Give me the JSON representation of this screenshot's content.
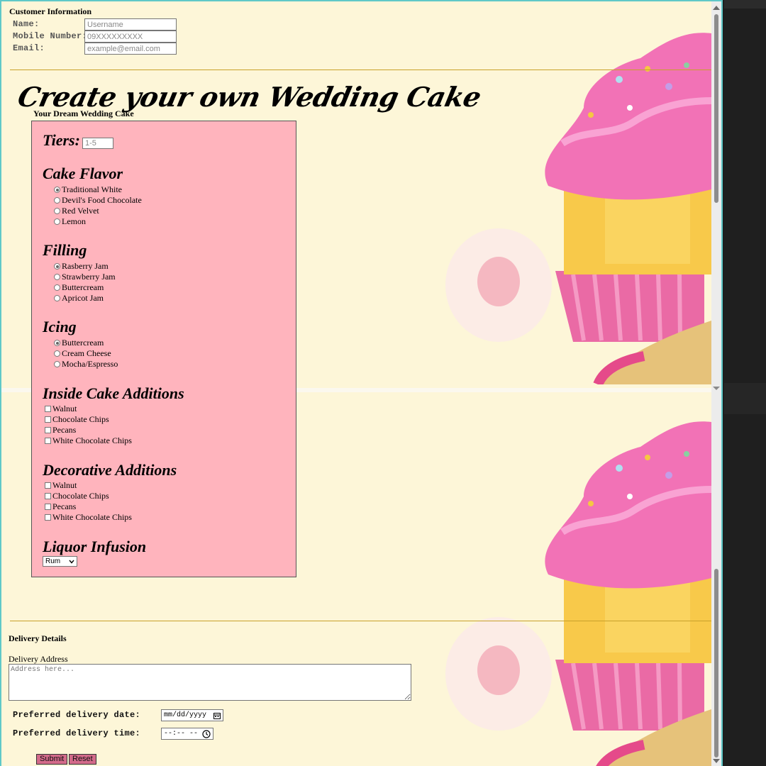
{
  "customer": {
    "heading": "Customer Information",
    "name_label": "Name:",
    "name_placeholder": "Username",
    "mobile_label": "Mobile Number:",
    "mobile_placeholder": "09XXXXXXXXX",
    "email_label": "Email:",
    "email_placeholder": "example@email.com"
  },
  "cake": {
    "headline": "Create your own Wedding Cake",
    "subheading": "Your Dream Wedding Cake",
    "tiers_label": "Tiers:",
    "tiers_placeholder": "1-5",
    "flavor": {
      "title": "Cake Flavor",
      "options": [
        "Traditional White",
        "Devil's Food Chocolate",
        "Red Velvet",
        "Lemon"
      ],
      "selected": 0
    },
    "filling": {
      "title": "Filling",
      "options": [
        "Rasberry Jam",
        "Strawberry Jam",
        "Buttercream",
        "Apricot Jam"
      ],
      "selected": 0
    },
    "icing": {
      "title": "Icing",
      "options": [
        "Buttercream",
        "Cream Cheese",
        "Mocha/Espresso"
      ],
      "selected": 0
    },
    "inside": {
      "title": "Inside Cake Additions",
      "options": [
        "Walnut",
        "Chocolate Chips",
        "Pecans",
        "White Chocolate Chips"
      ]
    },
    "decorative": {
      "title": "Decorative Additions",
      "options": [
        "Walnut",
        "Chocolate Chips",
        "Pecans",
        "White Chocolate Chips"
      ]
    },
    "liquor": {
      "title": "Liquor Infusion",
      "selected": "Rum"
    }
  },
  "delivery": {
    "heading": "Delivery Details",
    "address_label": "Delivery Address",
    "address_placeholder": "Address here...",
    "date_label": "Preferred delivery date:",
    "date_value": "mm/dd/yyyy",
    "time_label": "Preferred delivery time:",
    "time_value": "--:-- --"
  },
  "buttons": {
    "submit": "Submit",
    "reset": "Reset"
  },
  "icons": {
    "calendar": "calendar-icon",
    "clock": "clock-icon",
    "dropdown": "chevron-down-icon"
  },
  "colors": {
    "page_bg": "#fdf6d8",
    "form_bg": "#ffb4bd",
    "button_bg": "#d36a8a",
    "rule": "#c8a12a",
    "window_border": "#5fc8c8"
  }
}
